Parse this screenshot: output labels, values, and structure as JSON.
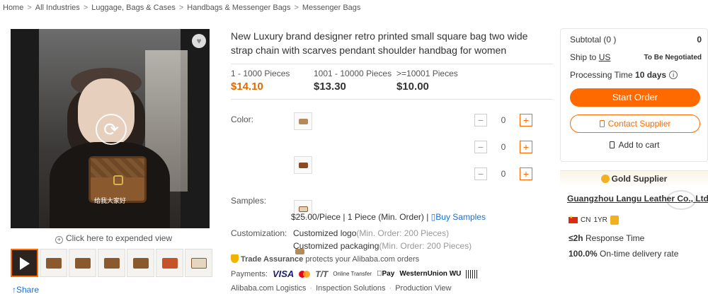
{
  "breadcrumb": [
    "Home",
    "All Industries",
    "Luggage, Bags & Cases",
    "Handbags & Messenger Bags",
    "Messenger Bags"
  ],
  "breadcrumb_sep": ">",
  "media": {
    "video_caption": "给我大家好",
    "expand_label": "Click here to expended view",
    "share_label": "↑Share",
    "thumb_count": 7
  },
  "product": {
    "title": "New Luxury brand designer retro printed small square bag two wide strap chain with scarves pendant shoulder handbag for women",
    "tiers": [
      {
        "range": "1 - 1000 Pieces",
        "price": "$14.10"
      },
      {
        "range": "1001 - 10000 Pieces",
        "price": "$13.30"
      },
      {
        "range": ">=10001 Pieces",
        "price": "$10.00"
      }
    ],
    "color_label": "Color:",
    "color_rows": [
      {
        "qty": "0"
      },
      {
        "qty": "0"
      },
      {
        "qty": "0"
      }
    ],
    "samples_label": "Samples:",
    "samples_price": "$25.00/Piece | 1 Piece (Min. Order) |",
    "buy_samples": "Buy Samples",
    "customization_label": "Customization:",
    "customizations": [
      {
        "name": "Customized logo",
        "min": "(Min. Order: 200 Pieces)"
      },
      {
        "name": "Customized packaging",
        "min": "(Min. Order: 200 Pieces)"
      }
    ],
    "trade_assurance": "Trade Assurance",
    "trade_assurance_text": "protects your Alibaba.com orders",
    "payments_label": "Payments:",
    "payment_methods": {
      "visa": "VISA",
      "tt": "T/T",
      "online": "Online Transfer",
      "apay": "Pay",
      "wu": "WesternUnion WU"
    },
    "bottom_links": [
      "Alibaba.com Logistics",
      "Inspection Solutions",
      "Production View"
    ]
  },
  "order_panel": {
    "subtotal_label": "Subtotal (0 )",
    "subtotal_value": "0",
    "ship_label": "Ship to",
    "ship_country": "US",
    "ship_status": "To Be Negotiated",
    "processing_label": "Processing Time",
    "processing_value": "10 days",
    "start_order": "Start Order",
    "contact_supplier": "Contact Supplier",
    "add_to_cart": "Add to cart"
  },
  "supplier": {
    "tier": "Gold Supplier",
    "name": "Guangzhou Langu Leather Co., Ltd.",
    "country": "CN",
    "years": "1YR",
    "response_value": "≤2h",
    "response_label": "Response Time",
    "ontime_value": "100.0%",
    "ontime_label": "On-time delivery rate"
  },
  "colors": {
    "accent": "#ff6a00",
    "link": "#1a6fd0",
    "price": "#e06900"
  }
}
